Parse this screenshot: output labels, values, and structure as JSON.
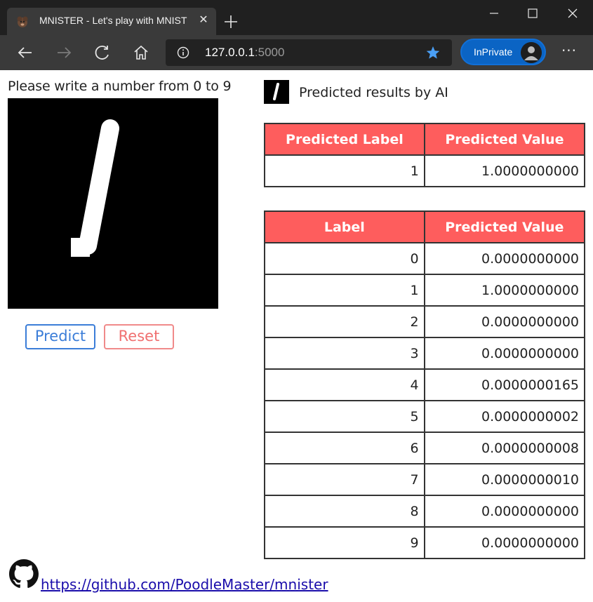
{
  "browser": {
    "tab_title": "MNISTER - Let's play with MNIST",
    "address_host": "127.0.0.1",
    "address_port": ":5000",
    "inprivate_label": "InPrivate"
  },
  "page": {
    "draw_prompt": "Please write a number from 0 to 9",
    "predict_label": "Predict",
    "reset_label": "Reset",
    "result_title": "Predicted results by AI",
    "top_table": {
      "headers": [
        "Predicted Label",
        "Predicted Value"
      ],
      "row": [
        "1",
        "1.0000000000"
      ]
    },
    "prob_table": {
      "headers": [
        "Label",
        "Predicted Value"
      ],
      "rows": [
        [
          "0",
          "0.0000000000"
        ],
        [
          "1",
          "1.0000000000"
        ],
        [
          "2",
          "0.0000000000"
        ],
        [
          "3",
          "0.0000000000"
        ],
        [
          "4",
          "0.0000000165"
        ],
        [
          "5",
          "0.0000000002"
        ],
        [
          "6",
          "0.0000000008"
        ],
        [
          "7",
          "0.0000000010"
        ],
        [
          "8",
          "0.0000000000"
        ],
        [
          "9",
          "0.0000000000"
        ]
      ]
    },
    "github_link": " https://github.com/PoodleMaster/mnister"
  },
  "colors": {
    "header_bg": "#fe5d5d",
    "predict_border": "#3b7dd8",
    "reset_border": "#f08a8a",
    "inprivate_bg": "#0b64c4"
  },
  "icons": [
    "poodle-favicon-icon",
    "close-icon",
    "plus-icon",
    "minimize-icon",
    "maximize-icon",
    "window-close-icon",
    "back-arrow-icon",
    "forward-arrow-icon",
    "refresh-icon",
    "home-icon",
    "info-icon",
    "star-icon",
    "avatar-icon",
    "more-icon",
    "github-icon"
  ]
}
